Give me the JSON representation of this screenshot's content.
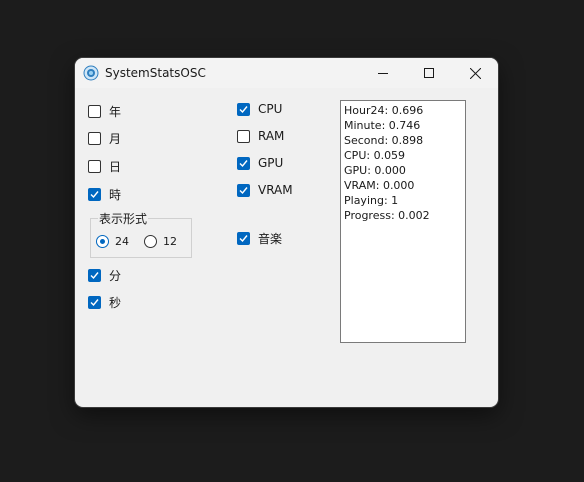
{
  "window": {
    "title": "SystemStatsOSC",
    "icon": "app-icon"
  },
  "date_time": {
    "year": {
      "label": "年",
      "checked": false
    },
    "month": {
      "label": "月",
      "checked": false
    },
    "day": {
      "label": "日",
      "checked": false
    },
    "hour": {
      "label": "時",
      "checked": true
    },
    "display_format": {
      "title": "表示形式",
      "options": [
        {
          "label": "24",
          "selected": true
        },
        {
          "label": "12",
          "selected": false
        }
      ]
    },
    "minute": {
      "label": "分",
      "checked": true
    },
    "second": {
      "label": "秒",
      "checked": true
    }
  },
  "system": {
    "cpu": {
      "label": "CPU",
      "checked": true
    },
    "ram": {
      "label": "RAM",
      "checked": false
    },
    "gpu": {
      "label": "GPU",
      "checked": true
    },
    "vram": {
      "label": "VRAM",
      "checked": true
    },
    "music": {
      "label": "音楽",
      "checked": true
    }
  },
  "stats": [
    "Hour24: 0.696",
    "Minute: 0.746",
    "Second: 0.898",
    "CPU: 0.059",
    "GPU: 0.000",
    "VRAM: 0.000",
    "Playing: 1",
    "Progress: 0.002"
  ],
  "colors": {
    "accent": "#0067c0",
    "window_bg": "#f0f0f0",
    "desktop_bg": "#1c1c1c"
  }
}
